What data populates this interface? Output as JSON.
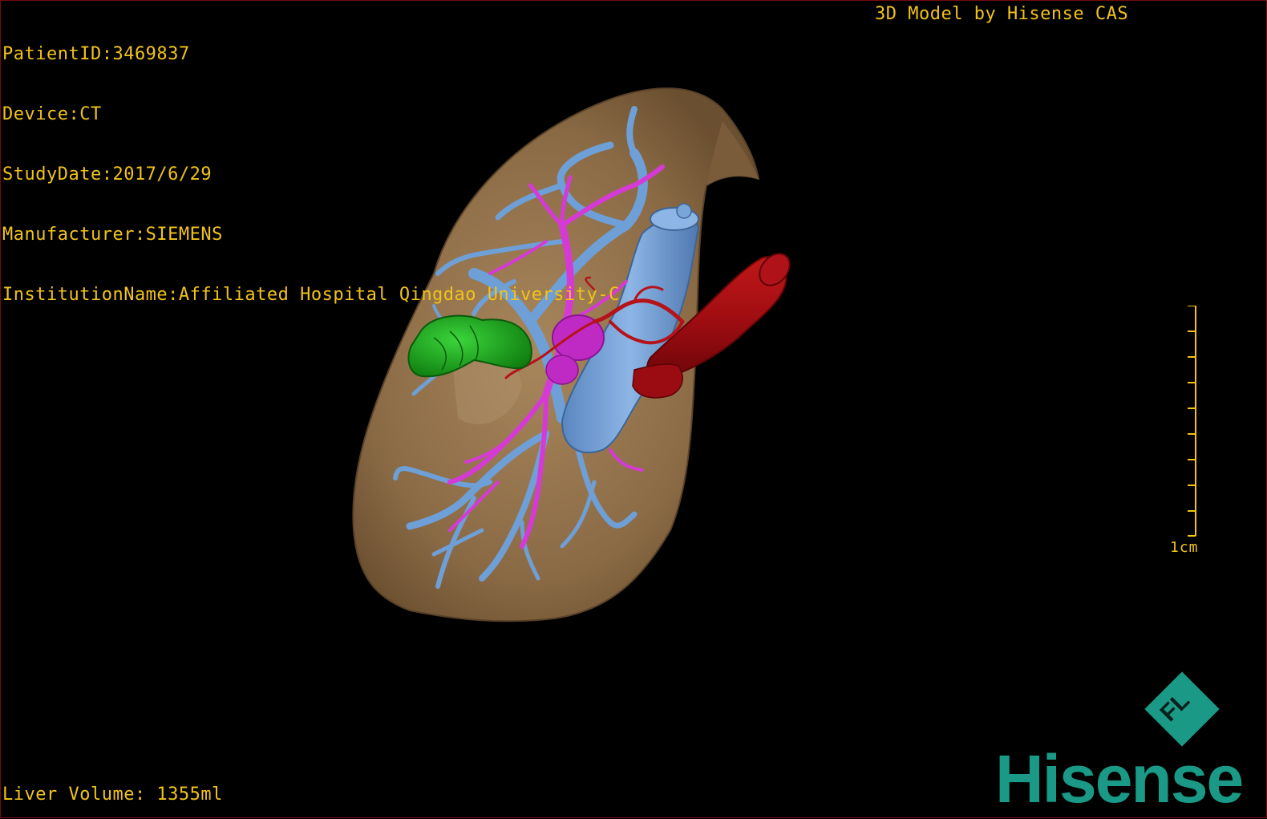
{
  "dicom_info": {
    "patient_id": "PatientID:3469837",
    "device": "Device:CT",
    "study_date": "StudyDate:2017/6/29",
    "manufacturer": "Manufacturer:SIEMENS",
    "institution": "InstitutionName:Affiliated Hospital Qingdao University-C"
  },
  "brand_caption": "3D Model by Hisense CAS",
  "liver_volume": "Liver Volume: 1355ml",
  "scale": {
    "label": "1cm"
  },
  "logo": {
    "mark_letters": "FL",
    "word": "Hisense"
  },
  "colors": {
    "overlay_text": "#f2c318",
    "liver": "#8a6a45",
    "portal_vein": "#6e9fd6",
    "hepatic_artery": "#c0101a",
    "bile_duct": "#d63ad6",
    "gallbladder": "#1fa51f",
    "brand": "#1a9a86"
  },
  "legend_icons": [
    "liver-surface",
    "portal-vein-tree",
    "bile-duct-tree",
    "aorta-artery",
    "gallbladder",
    "scale-ruler",
    "hisense-logo"
  ]
}
